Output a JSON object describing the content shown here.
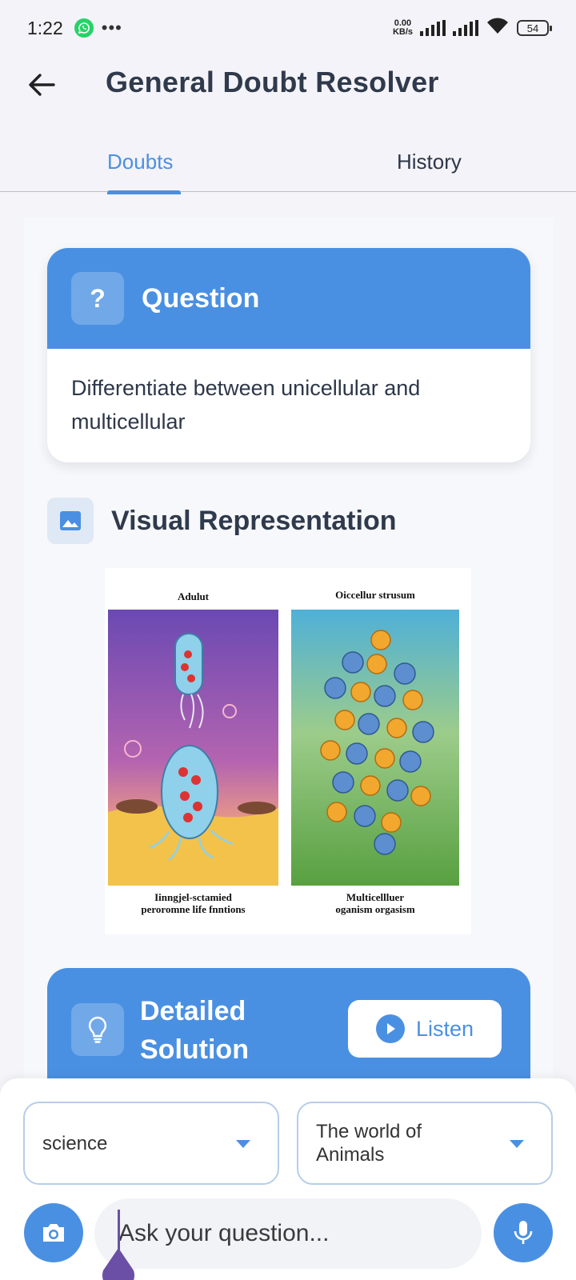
{
  "status_bar": {
    "time": "1:22",
    "net_speed_value": "0.00",
    "net_speed_unit": "KB/s",
    "battery": "54",
    "icons": [
      "whatsapp-icon",
      "more-icon",
      "signal-icon",
      "signal-icon",
      "wifi-icon",
      "battery-icon"
    ]
  },
  "header": {
    "title": "General Doubt Resolver",
    "tabs": [
      {
        "label": "Doubts",
        "active": true
      },
      {
        "label": "History",
        "active": false
      }
    ]
  },
  "question": {
    "heading": "Question",
    "icon_text": "?",
    "text": "Differentiate between unicellular and multicellular"
  },
  "visual": {
    "heading": "Visual Representation",
    "left_title": "Adulut",
    "right_title": "Oiccellur strusum",
    "left_caption_1": "Iinngjel-sctamied",
    "left_caption_2": "peroromne life fnntions",
    "right_caption_1": "Multicellluer",
    "right_caption_2": "oganism orgasism"
  },
  "solution": {
    "heading_line1": "Detailed",
    "heading_line2": "Solution",
    "listen_label": "Listen"
  },
  "input": {
    "subject_value": "science",
    "topic_value_line1": "The world of",
    "topic_value_line2": "Animals",
    "placeholder": "Ask your question...",
    "accent": "#4a90e2"
  }
}
